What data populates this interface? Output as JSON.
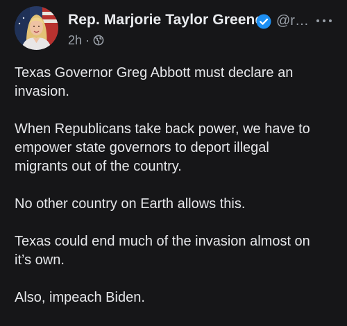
{
  "post": {
    "author_name": "Rep. Marjorie Taylor Greene",
    "handle": "@r…",
    "time_ago": "2h",
    "separator": "·",
    "visibility_icon": "globe-icon",
    "verified_icon": "verified-badge-icon",
    "more_icon": "more-options-icon",
    "paragraphs": [
      "Texas Governor Greg Abbott must declare an\ninvasion.",
      "When Republicans take back power, we have to\nempower state governors to deport illegal\nmigrants out of the country.",
      "No other country on Earth allows this.",
      "Texas could end much of the invasion almost on\nit’s own.",
      "Also, impeach Biden."
    ]
  },
  "colors": {
    "background": "#161618",
    "text_primary": "#e6e7ea",
    "text_secondary": "#9aa0a8",
    "verified_blue": "#1d8ff2"
  }
}
